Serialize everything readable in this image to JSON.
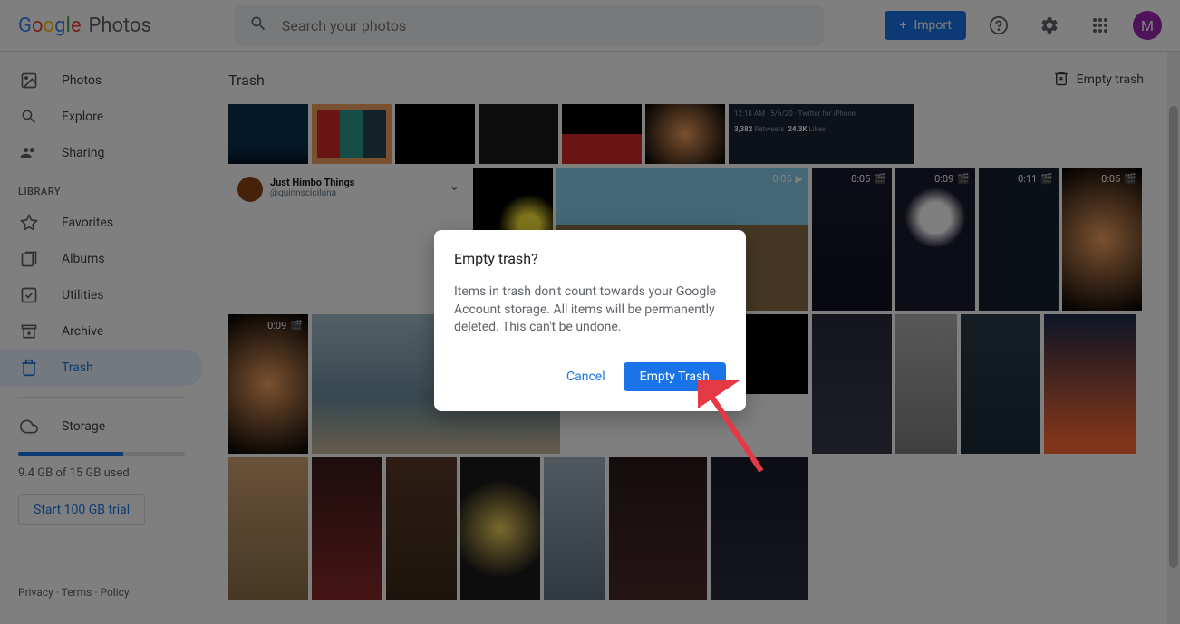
{
  "header": {
    "logo_photos": "Photos",
    "search_placeholder": "Search your photos",
    "import_label": "Import",
    "avatar_letter": "M"
  },
  "sidebar": {
    "items": [
      {
        "label": "Photos"
      },
      {
        "label": "Explore"
      },
      {
        "label": "Sharing"
      }
    ],
    "library_label": "LIBRARY",
    "library_items": [
      {
        "label": "Favorites"
      },
      {
        "label": "Albums"
      },
      {
        "label": "Utilities"
      },
      {
        "label": "Archive"
      },
      {
        "label": "Trash"
      }
    ],
    "storage_label": "Storage",
    "storage_text": "9.4 GB of 15 GB used",
    "trial_label": "Start 100 GB trial"
  },
  "footer": {
    "privacy": "Privacy",
    "terms": "Terms",
    "policy": "Policy"
  },
  "content": {
    "title": "Trash",
    "empty_trash_label": "Empty trash"
  },
  "thumbs": {
    "row2": [
      {
        "badge": "0:05"
      },
      {
        "badge": "0:05"
      },
      {
        "badge": "0:09"
      },
      {
        "badge": "0:11"
      },
      {
        "badge": "0:05"
      }
    ],
    "row3_badge": "0:09",
    "tweet": {
      "time": "12:18 AM · 5/6/20 · Twitter for iPhone",
      "retweets": "3,382",
      "rt_label": "Retweets",
      "likes": "24.3K",
      "likes_label": "Likes"
    },
    "social": {
      "name": "Just Himbo Things",
      "handle": "@quinnsciciluna"
    }
  },
  "dialog": {
    "title": "Empty trash?",
    "body": "Items in trash don't count towards your Google Account storage. All items will be permanently deleted. This can't be undone.",
    "cancel": "Cancel",
    "confirm": "Empty Trash"
  }
}
